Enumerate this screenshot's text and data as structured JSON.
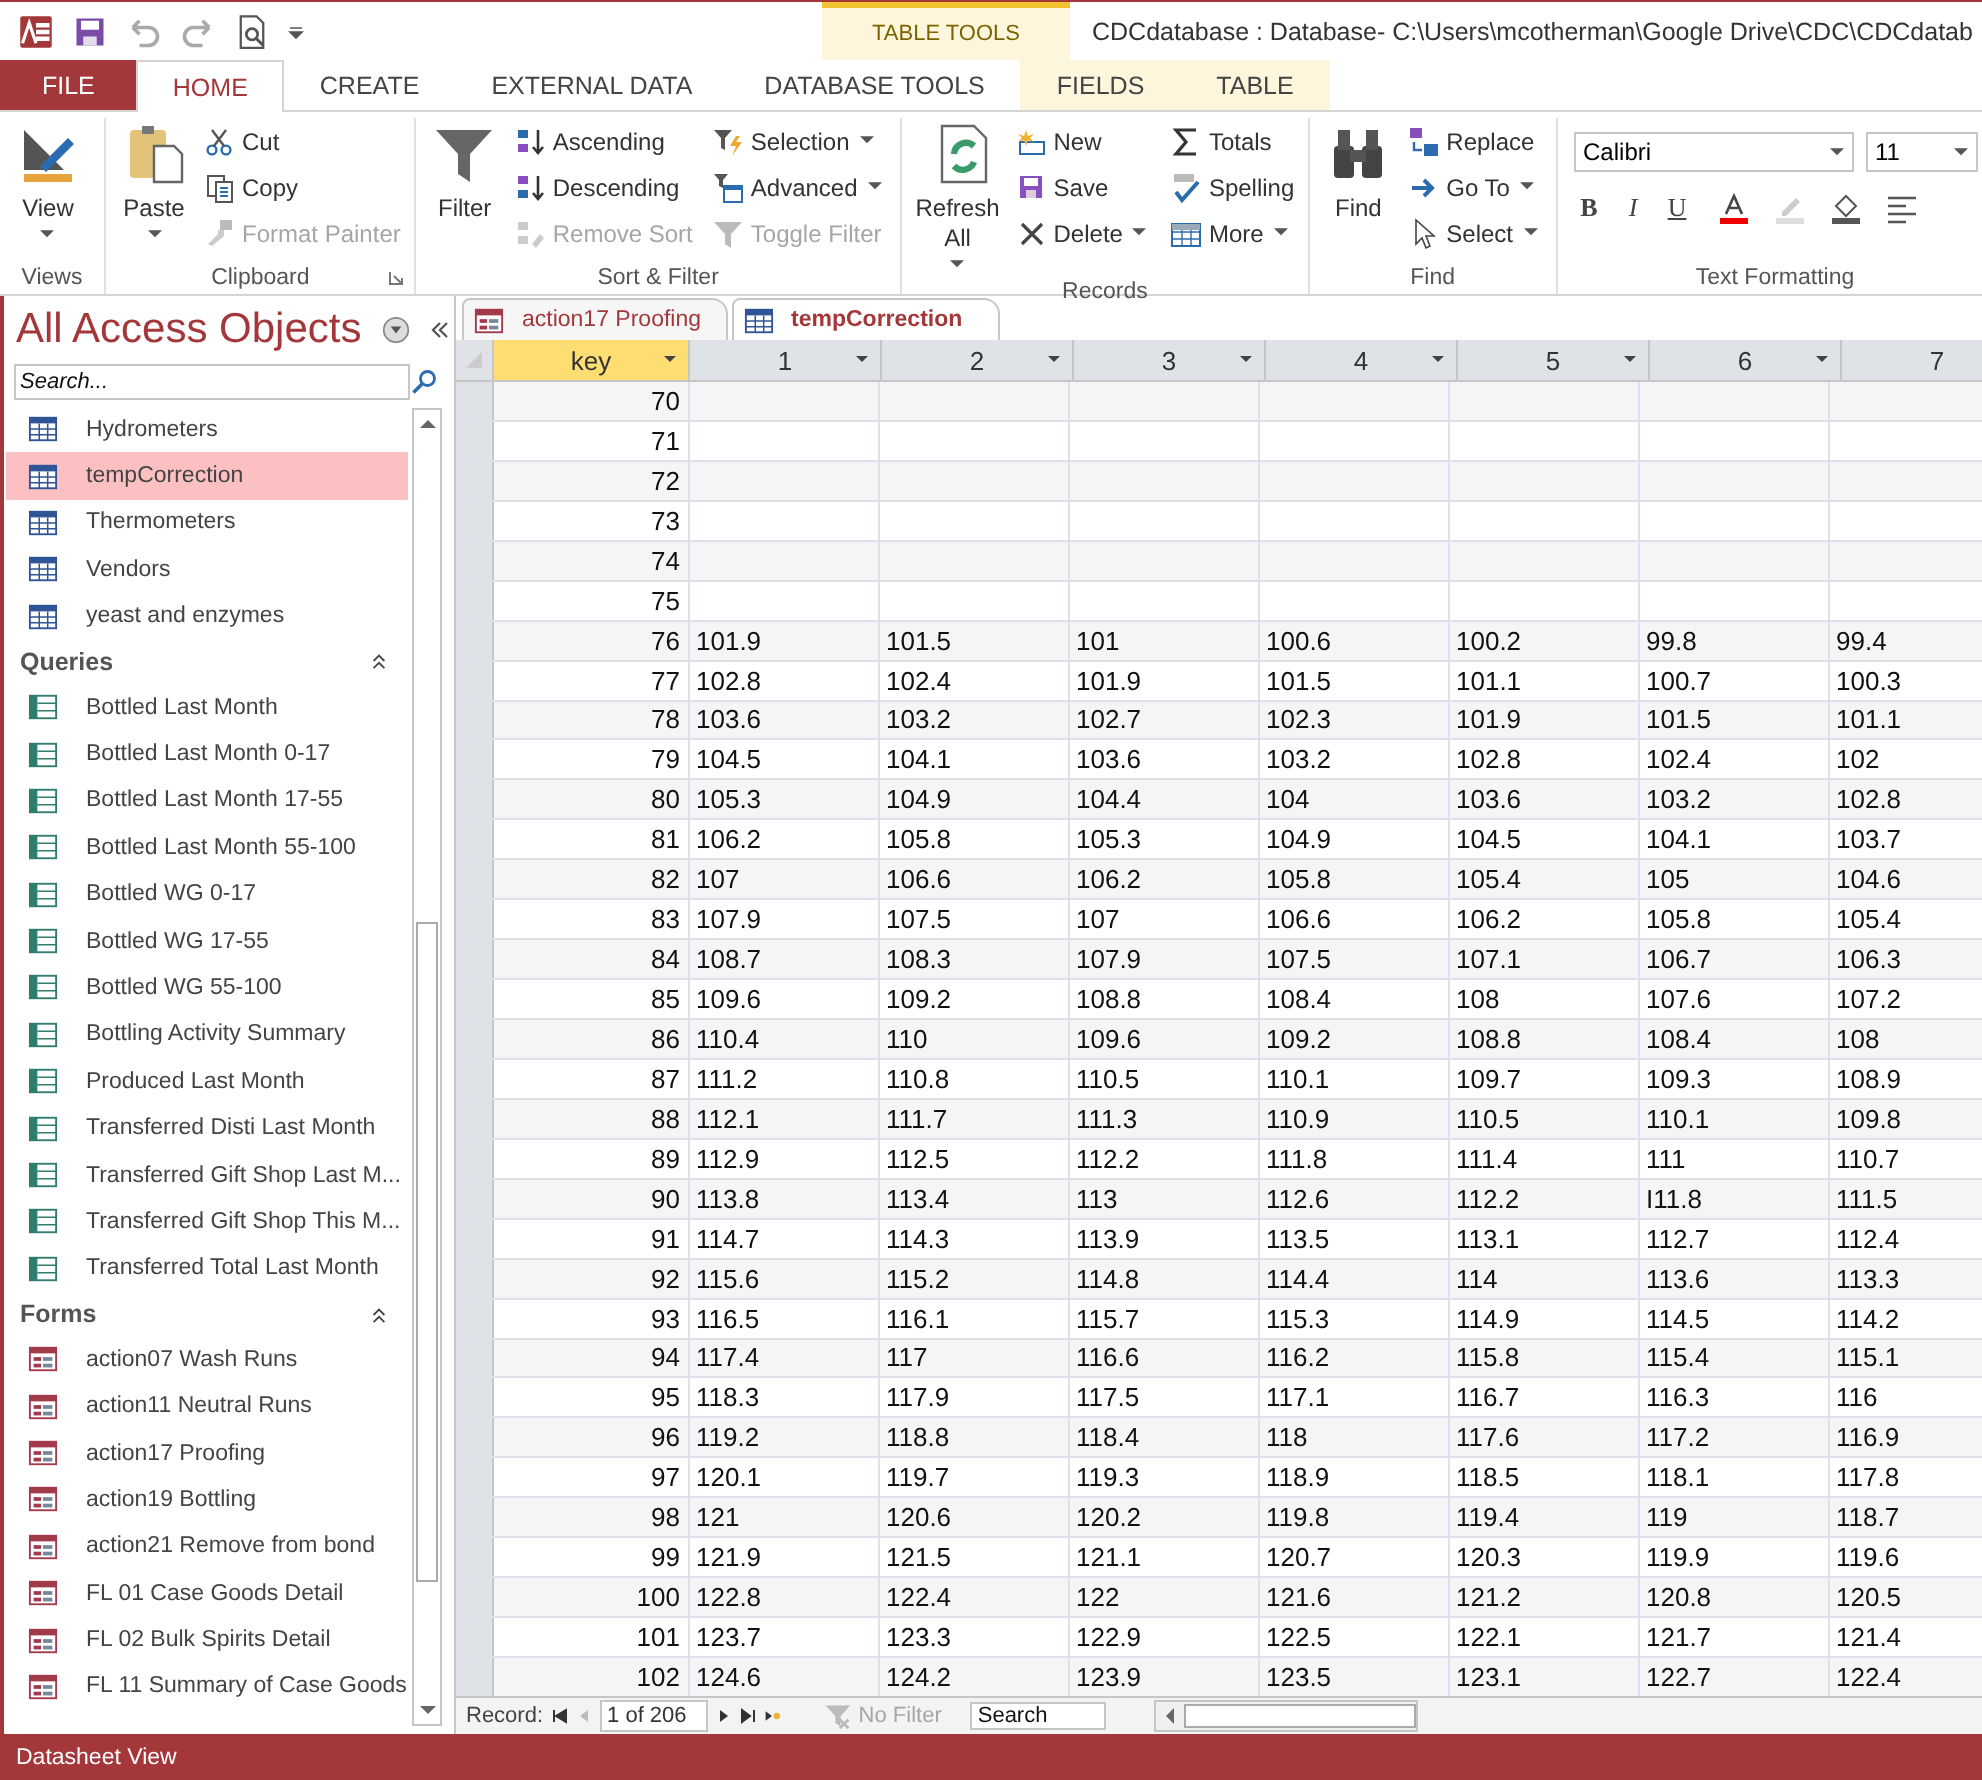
{
  "title_bar": {
    "title": "CDCdatabase : Database- C:\\Users\\mcotherman\\Google Drive\\CDC\\CDCdatab",
    "context_label": "TABLE TOOLS"
  },
  "ribbon_tabs": [
    {
      "label": "FILE",
      "kind": "file",
      "selected": false
    },
    {
      "label": "HOME",
      "kind": "tab",
      "selected": true
    },
    {
      "label": "CREATE",
      "kind": "tab",
      "selected": false
    },
    {
      "label": "EXTERNAL DATA",
      "kind": "tab",
      "selected": false
    },
    {
      "label": "DATABASE TOOLS",
      "kind": "tab",
      "selected": false
    },
    {
      "label": "FIELDS",
      "kind": "context",
      "selected": false
    },
    {
      "label": "TABLE",
      "kind": "context",
      "selected": false
    }
  ],
  "ribbon": {
    "groups": [
      {
        "title": "Views",
        "launcher": false,
        "items": [
          {
            "label": "View",
            "kind": "large",
            "dropdown": true,
            "disabled": false
          }
        ]
      },
      {
        "title": "Clipboard",
        "launcher": true,
        "items": [
          {
            "label": "Paste",
            "kind": "large",
            "dropdown": true,
            "disabled": false
          },
          {
            "label": "Cut",
            "kind": "small",
            "dropdown": false,
            "disabled": false
          },
          {
            "label": "Copy",
            "kind": "small",
            "dropdown": false,
            "disabled": false
          },
          {
            "label": "Format Painter",
            "kind": "small",
            "dropdown": false,
            "disabled": true
          }
        ]
      },
      {
        "title": "Sort & Filter",
        "launcher": false,
        "items": [
          {
            "label": "Filter",
            "kind": "large",
            "dropdown": false,
            "disabled": false
          },
          {
            "label": "Ascending",
            "kind": "small",
            "dropdown": false,
            "disabled": false
          },
          {
            "label": "Descending",
            "kind": "small",
            "dropdown": false,
            "disabled": false
          },
          {
            "label": "Remove Sort",
            "kind": "small",
            "dropdown": false,
            "disabled": true
          },
          {
            "label": "Selection",
            "kind": "small",
            "dropdown": true,
            "disabled": false
          },
          {
            "label": "Advanced",
            "kind": "small",
            "dropdown": true,
            "disabled": false
          },
          {
            "label": "Toggle Filter",
            "kind": "small",
            "dropdown": false,
            "disabled": true
          }
        ]
      },
      {
        "title": "Records",
        "launcher": false,
        "items": [
          {
            "label": "Refresh All",
            "kind": "large",
            "dropdown": true,
            "disabled": false
          },
          {
            "label": "New",
            "kind": "small",
            "dropdown": false,
            "disabled": false
          },
          {
            "label": "Save",
            "kind": "small",
            "dropdown": false,
            "disabled": false
          },
          {
            "label": "Delete",
            "kind": "small",
            "dropdown": true,
            "disabled": false
          },
          {
            "label": "Totals",
            "kind": "small",
            "dropdown": false,
            "disabled": false
          },
          {
            "label": "Spelling",
            "kind": "small",
            "dropdown": false,
            "disabled": false
          },
          {
            "label": "More",
            "kind": "small",
            "dropdown": true,
            "disabled": false
          }
        ]
      },
      {
        "title": "Find",
        "launcher": false,
        "items": [
          {
            "label": "Find",
            "kind": "large",
            "dropdown": false,
            "disabled": false
          },
          {
            "label": "Replace",
            "kind": "small",
            "dropdown": false,
            "disabled": false
          },
          {
            "label": "Go To",
            "kind": "small",
            "dropdown": true,
            "disabled": false
          },
          {
            "label": "Select",
            "kind": "small",
            "dropdown": true,
            "disabled": false
          }
        ]
      }
    ],
    "text_formatting": {
      "title": "Text Formatting",
      "font": "Calibri",
      "size": "11",
      "styles": [
        "B",
        "I",
        "U"
      ]
    }
  },
  "nav": {
    "title": "All Access Objects",
    "search_placeholder": "Search...",
    "groups": [
      {
        "kind": "table",
        "items": [
          {
            "label": "Hydrometers",
            "selected": false
          },
          {
            "label": "tempCorrection",
            "selected": true
          },
          {
            "label": "Thermometers",
            "selected": false
          },
          {
            "label": "Vendors",
            "selected": false
          },
          {
            "label": "yeast and enzymes",
            "selected": false
          }
        ]
      },
      {
        "title": "Queries",
        "kind": "query",
        "items": [
          {
            "label": "Bottled Last Month",
            "selected": false
          },
          {
            "label": "Bottled Last Month 0-17",
            "selected": false
          },
          {
            "label": "Bottled Last Month 17-55",
            "selected": false
          },
          {
            "label": "Bottled Last Month 55-100",
            "selected": false
          },
          {
            "label": "Bottled WG 0-17",
            "selected": false
          },
          {
            "label": "Bottled WG 17-55",
            "selected": false
          },
          {
            "label": "Bottled WG 55-100",
            "selected": false
          },
          {
            "label": "Bottling Activity Summary",
            "selected": false
          },
          {
            "label": "Produced Last Month",
            "selected": false
          },
          {
            "label": "Transferred Disti Last Month",
            "selected": false
          },
          {
            "label": "Transferred Gift Shop Last M...",
            "selected": false
          },
          {
            "label": "Transferred Gift Shop This M...",
            "selected": false
          },
          {
            "label": "Transferred Total Last Month",
            "selected": false
          }
        ]
      },
      {
        "title": "Forms",
        "kind": "form",
        "items": [
          {
            "label": "action07 Wash Runs",
            "selected": false
          },
          {
            "label": "action11 Neutral Runs",
            "selected": false
          },
          {
            "label": "action17 Proofing",
            "selected": false
          },
          {
            "label": "action19 Bottling",
            "selected": false
          },
          {
            "label": "action21 Remove from bond",
            "selected": false
          },
          {
            "label": "FL 01 Case Goods Detail",
            "selected": false
          },
          {
            "label": "FL 02 Bulk Spirits Detail",
            "selected": false
          },
          {
            "label": "FL 11 Summary of Case Goods",
            "selected": false
          }
        ]
      }
    ]
  },
  "document_tabs": [
    {
      "label": "action17 Proofing",
      "kind": "form",
      "selected": false
    },
    {
      "label": "tempCorrection",
      "kind": "table",
      "selected": true
    }
  ],
  "table": {
    "columns": [
      {
        "label": "key",
        "selected": true
      },
      {
        "label": "1",
        "selected": false
      },
      {
        "label": "2",
        "selected": false
      },
      {
        "label": "3",
        "selected": false
      },
      {
        "label": "4",
        "selected": false
      },
      {
        "label": "5",
        "selected": false
      },
      {
        "label": "6",
        "selected": false
      },
      {
        "label": "7",
        "selected": false
      }
    ],
    "rows": [
      {
        "key": "70"
      },
      {
        "key": "71"
      },
      {
        "key": "72"
      },
      {
        "key": "73"
      },
      {
        "key": "74"
      },
      {
        "key": "75"
      },
      {
        "key": "76",
        "cells": [
          "101.9",
          "101.5",
          "101",
          "100.6",
          "100.2",
          "99.8",
          "99.4"
        ]
      },
      {
        "key": "77",
        "cells": [
          "102.8",
          "102.4",
          "101.9",
          "101.5",
          "101.1",
          "100.7",
          "100.3"
        ]
      },
      {
        "key": "78",
        "cells": [
          "103.6",
          "103.2",
          "102.7",
          "102.3",
          "101.9",
          "101.5",
          "101.1"
        ]
      },
      {
        "key": "79",
        "cells": [
          "104.5",
          "104.1",
          "103.6",
          "103.2",
          "102.8",
          "102.4",
          "102"
        ]
      },
      {
        "key": "80",
        "cells": [
          "105.3",
          "104.9",
          "104.4",
          "104",
          "103.6",
          "103.2",
          "102.8"
        ]
      },
      {
        "key": "81",
        "cells": [
          "106.2",
          "105.8",
          "105.3",
          "104.9",
          "104.5",
          "104.1",
          "103.7"
        ]
      },
      {
        "key": "82",
        "cells": [
          "107",
          "106.6",
          "106.2",
          "105.8",
          "105.4",
          "105",
          "104.6"
        ]
      },
      {
        "key": "83",
        "cells": [
          "107.9",
          "107.5",
          "107",
          "106.6",
          "106.2",
          "105.8",
          "105.4"
        ]
      },
      {
        "key": "84",
        "cells": [
          "108.7",
          "108.3",
          "107.9",
          "107.5",
          "107.1",
          "106.7",
          "106.3"
        ]
      },
      {
        "key": "85",
        "cells": [
          "109.6",
          "109.2",
          "108.8",
          "108.4",
          "108",
          "107.6",
          "107.2"
        ]
      },
      {
        "key": "86",
        "cells": [
          "110.4",
          "110",
          "109.6",
          "109.2",
          "108.8",
          "108.4",
          "108"
        ]
      },
      {
        "key": "87",
        "cells": [
          "111.2",
          "110.8",
          "110.5",
          "110.1",
          "109.7",
          "109.3",
          "108.9"
        ]
      },
      {
        "key": "88",
        "cells": [
          "112.1",
          "111.7",
          "111.3",
          "110.9",
          "110.5",
          "110.1",
          "109.8"
        ]
      },
      {
        "key": "89",
        "cells": [
          "112.9",
          "112.5",
          "112.2",
          "111.8",
          "111.4",
          "111",
          "110.7"
        ]
      },
      {
        "key": "90",
        "cells": [
          "113.8",
          "113.4",
          "113",
          "112.6",
          "112.2",
          "I11.8",
          "111.5"
        ]
      },
      {
        "key": "91",
        "cells": [
          "114.7",
          "114.3",
          "113.9",
          "113.5",
          "113.1",
          "112.7",
          "112.4"
        ]
      },
      {
        "key": "92",
        "cells": [
          "115.6",
          "115.2",
          "114.8",
          "114.4",
          "114",
          "113.6",
          "113.3"
        ]
      },
      {
        "key": "93",
        "cells": [
          "116.5",
          "116.1",
          "115.7",
          "115.3",
          "114.9",
          "114.5",
          "114.2"
        ]
      },
      {
        "key": "94",
        "cells": [
          "117.4",
          "117",
          "116.6",
          "116.2",
          "115.8",
          "115.4",
          "115.1"
        ]
      },
      {
        "key": "95",
        "cells": [
          "118.3",
          "117.9",
          "117.5",
          "117.1",
          "116.7",
          "116.3",
          "116"
        ]
      },
      {
        "key": "96",
        "cells": [
          "119.2",
          "118.8",
          "118.4",
          "118",
          "117.6",
          "117.2",
          "116.9"
        ]
      },
      {
        "key": "97",
        "cells": [
          "120.1",
          "119.7",
          "119.3",
          "118.9",
          "118.5",
          "118.1",
          "117.8"
        ]
      },
      {
        "key": "98",
        "cells": [
          "121",
          "120.6",
          "120.2",
          "119.8",
          "119.4",
          "119",
          "118.7"
        ]
      },
      {
        "key": "99",
        "cells": [
          "121.9",
          "121.5",
          "121.1",
          "120.7",
          "120.3",
          "119.9",
          "119.6"
        ]
      },
      {
        "key": "100",
        "cells": [
          "122.8",
          "122.4",
          "122",
          "121.6",
          "121.2",
          "120.8",
          "120.5"
        ]
      },
      {
        "key": "101",
        "cells": [
          "123.7",
          "123.3",
          "122.9",
          "122.5",
          "122.1",
          "121.7",
          "121.4"
        ]
      },
      {
        "key": "102",
        "cells": [
          "124.6",
          "124.2",
          "123.9",
          "123.5",
          "123.1",
          "122.7",
          "122.4"
        ]
      }
    ]
  },
  "record_bar": {
    "label": "Record:",
    "position": "1 of 206",
    "filter": "No Filter",
    "search_placeholder": "Search"
  },
  "status_bar": {
    "text": "Datasheet View"
  }
}
